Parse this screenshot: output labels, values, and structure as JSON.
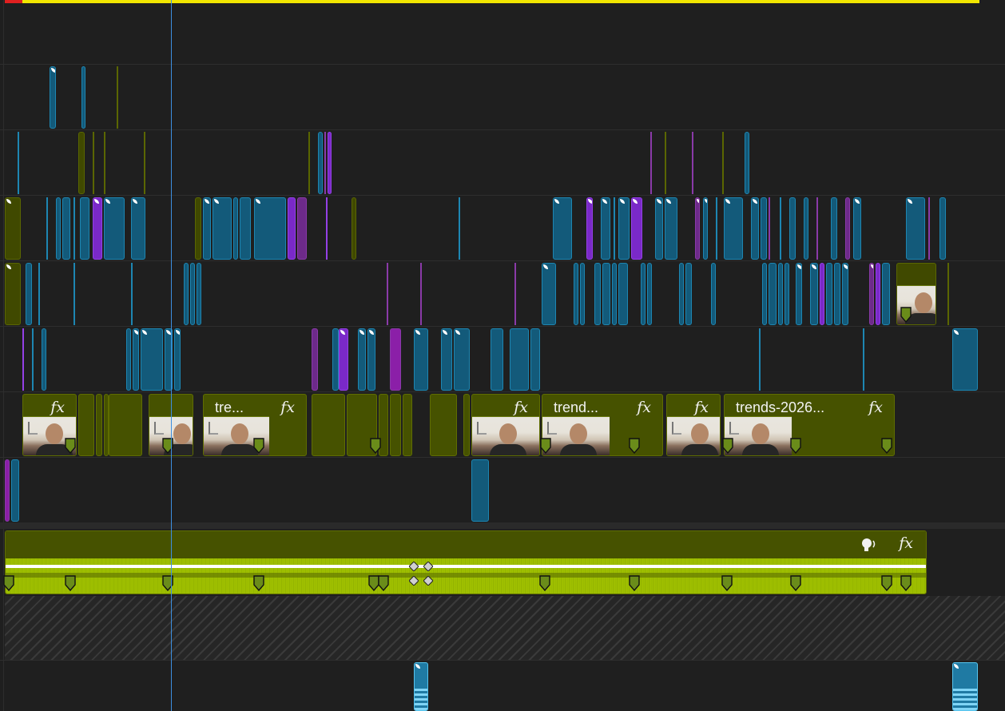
{
  "sequence": {
    "work_area_color": "#f2e600",
    "in_marker_color": "#e02020",
    "playhead_color": "#3d8fe0"
  },
  "video_track_1": {
    "clips": [
      {
        "label": ""
      },
      {
        "label": "tre..."
      },
      {
        "label": ""
      },
      {
        "label": "trend..."
      },
      {
        "label": ""
      },
      {
        "label": "trends-2026..."
      }
    ],
    "fx_label": "fx"
  },
  "audio_track_1": {
    "voice_icon": "speech-icon",
    "fx_label": "fx",
    "waveform_color": "#a3c400",
    "header_color": "#465200"
  },
  "icons": {
    "keyframe": "keyframe-marker-icon",
    "fx_badge": "fx-badge-icon",
    "voice": "voice-enhance-icon"
  }
}
